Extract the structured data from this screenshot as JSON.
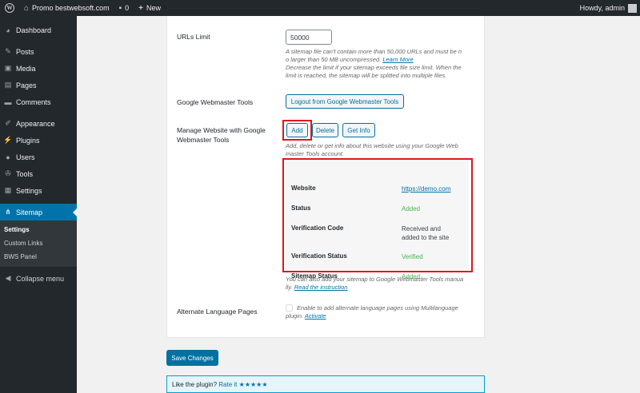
{
  "adminbar": {
    "site_name": "Promo bestwebsoft.com",
    "comments_count": "0",
    "new_label": "New",
    "greeting": "Howdy, admin"
  },
  "sidebar": {
    "items": [
      {
        "label": "Dashboard",
        "icon": "dashboard-icon"
      },
      {
        "label": "Posts",
        "icon": "pin-icon"
      },
      {
        "label": "Media",
        "icon": "media-icon"
      },
      {
        "label": "Pages",
        "icon": "pages-icon"
      },
      {
        "label": "Comments",
        "icon": "comments-icon"
      },
      {
        "label": "Appearance",
        "icon": "brush-icon"
      },
      {
        "label": "Plugins",
        "icon": "plugin-icon"
      },
      {
        "label": "Users",
        "icon": "users-icon"
      },
      {
        "label": "Tools",
        "icon": "wrench-icon"
      },
      {
        "label": "Settings",
        "icon": "settings-icon"
      },
      {
        "label": "Sitemap",
        "icon": "sitemap-icon"
      }
    ],
    "submenu": [
      "Settings",
      "Custom Links",
      "BWS Panel"
    ],
    "collapse": "Collapse menu"
  },
  "form": {
    "urls_limit_label": "URLs Limit",
    "urls_limit_value": "50000",
    "urls_desc_1": "A sitemap file can't contain more than 50,000 URLs and must be n",
    "urls_desc_2": "o larger than 50 MB uncompressed.",
    "urls_desc_link": "Learn More",
    "urls_desc_3": "Decrease the limit if your sitemap exceeds file size limit. When the",
    "urls_desc_4": "limit is reached, the sitemap will be splitted into multiple files.",
    "gwt_label": "Google Webmaster Tools",
    "logout_button": "Logout from Google Webmaster Tools",
    "manage_label_1": "Manage Website with Google",
    "manage_label_2": "Webmaster Tools",
    "add_button": "Add",
    "delete_button": "Delete",
    "getinfo_button": "Get Info",
    "manage_desc_1": "Add, delete or get info about this website using your Google Web",
    "manage_desc_2": "master Tools account.",
    "info": {
      "website_label": "Website",
      "website_value": "https://demo.com",
      "status_label": "Status",
      "status_value": "Added",
      "verification_code_label": "Verification Code",
      "verification_code_value_1": "Received and",
      "verification_code_value_2": "added to the site",
      "verification_status_label": "Verification Status",
      "verification_status_value": "Verified",
      "sitemap_status_label": "Sitemap Status",
      "sitemap_status_value": "Added"
    },
    "manual_desc_1": "You can also add your sitemap to Google Webmaster Tools manua",
    "manual_desc_2": "lly.",
    "manual_link": "Read the instruction",
    "alt_lang_label": "Alternate Language Pages",
    "alt_lang_desc_1": "Enable to add alternate language pages using Multilanguage",
    "alt_lang_desc_2": "plugin.",
    "alt_lang_link": "Activate"
  },
  "save_button": "Save Changes",
  "rate": {
    "text": "Like the plugin?",
    "link": "Rate it",
    "stars": "★★★★★"
  },
  "colors": {
    "accent": "#0073aa",
    "highlight": "#e0161d",
    "success": "#46b450"
  }
}
